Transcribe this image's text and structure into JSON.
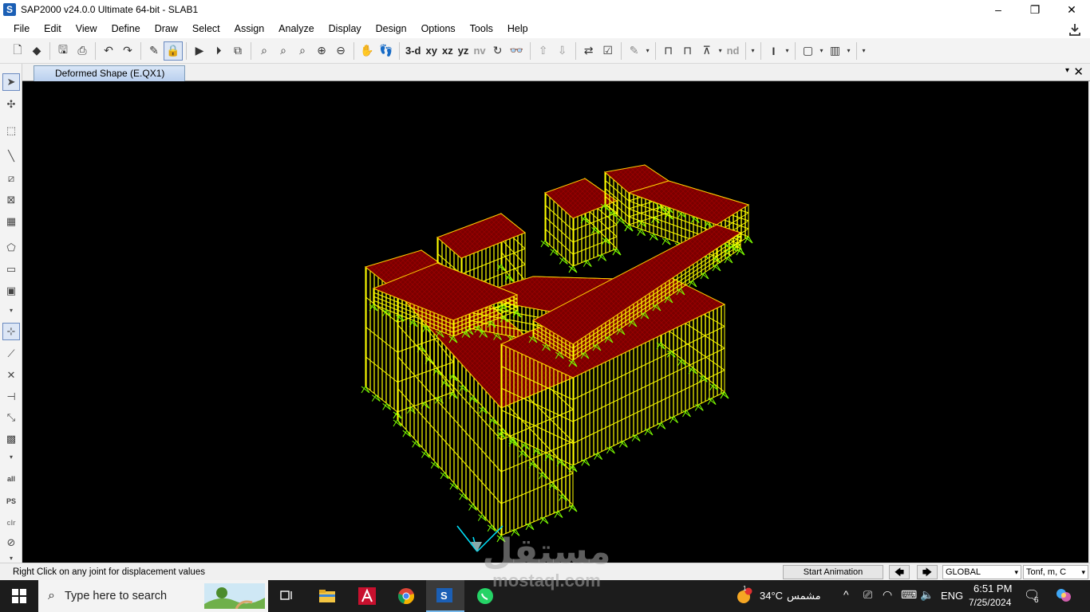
{
  "window": {
    "title": "SAP2000 v24.0.0 Ultimate 64-bit - SLAB1",
    "logo_letter": "S",
    "controls": [
      "–",
      "❐",
      "✕"
    ]
  },
  "menu": [
    "File",
    "Edit",
    "View",
    "Define",
    "Draw",
    "Select",
    "Assign",
    "Analyze",
    "Display",
    "Design",
    "Options",
    "Tools",
    "Help"
  ],
  "toolbar": {
    "view_3d": "3-d",
    "view_xy": "xy",
    "view_xz": "xz",
    "view_yz": "yz",
    "view_nv": "nv",
    "nd": "nd"
  },
  "left_toolbar": {
    "all": "all",
    "ps": "PS",
    "clr": "clr"
  },
  "document": {
    "tab_label": "Deformed Shape (E.QX1)",
    "menu_glyph": "▾",
    "close_glyph": "✕"
  },
  "viewport": {
    "background": "#000000",
    "slab_color": "#8b0000",
    "column_color": "#ffff00",
    "support_color": "#7cfc00",
    "axis_color": "#00e5ff"
  },
  "status": {
    "message": "Right Click on any joint for displacement values",
    "animation_button": "Start Animation",
    "prev_arrow": "🡄",
    "next_arrow": "🡆",
    "coord_system": "GLOBAL",
    "units": "Tonf, m, C"
  },
  "taskbar": {
    "search_placeholder": "Type here to search",
    "weather_temp": "34°C",
    "weather_desc": "مشمس",
    "language": "ENG",
    "time": "6:51 PM",
    "date": "7/25/2024",
    "notification_count": "6",
    "weather_badge": "1"
  },
  "watermark": {
    "arabic": "مستقل",
    "latin": "mostaql.com"
  }
}
